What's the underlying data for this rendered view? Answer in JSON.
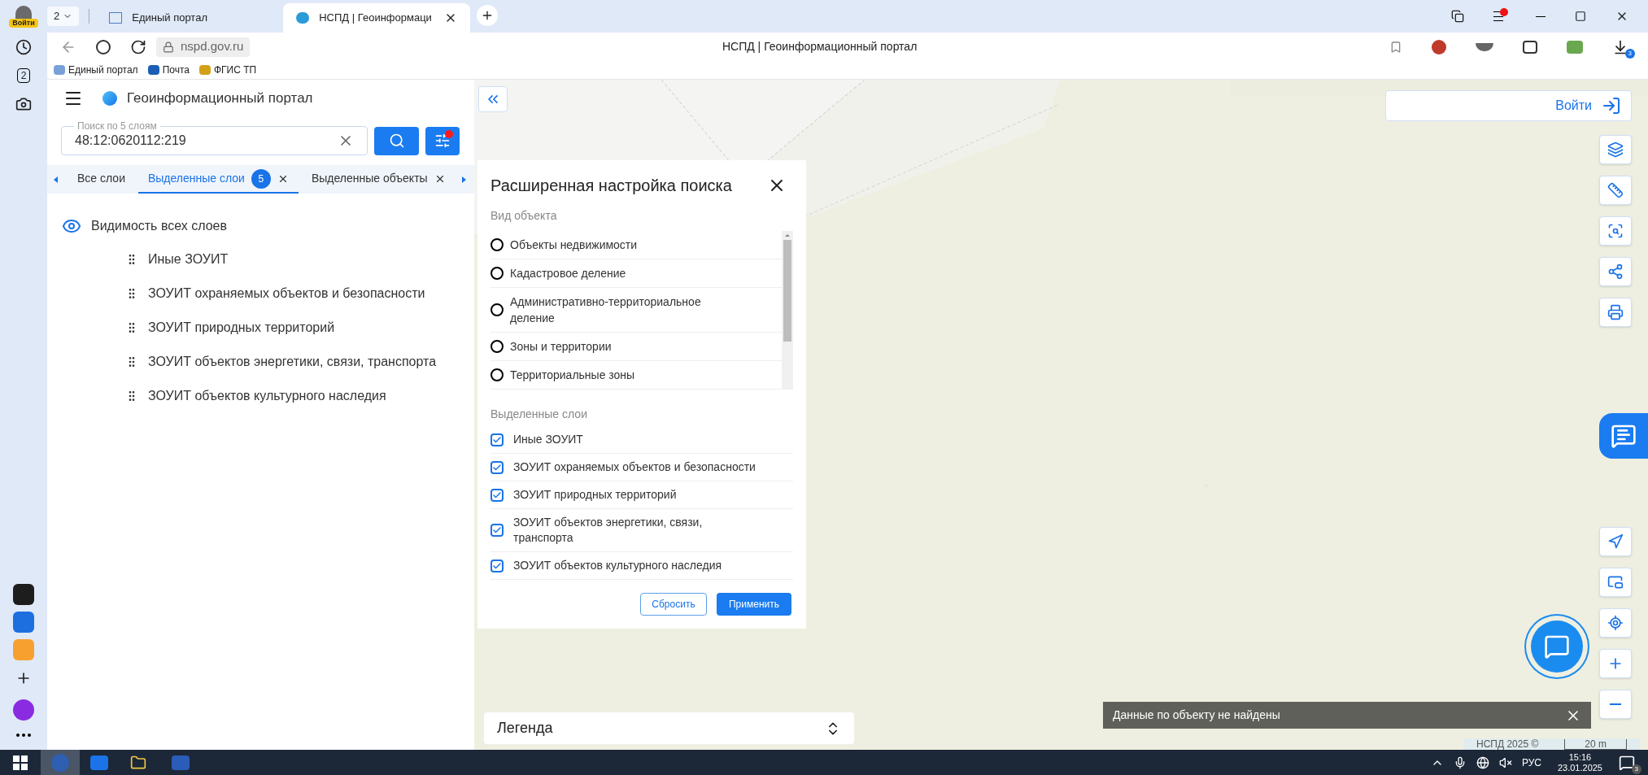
{
  "browser": {
    "profile_label": "Войти",
    "tab_count": "2",
    "tabs": [
      {
        "title": "Единый портал",
        "selected": false
      },
      {
        "title": "НСПД | Геоинформаци",
        "selected": true
      }
    ],
    "url": "nspd.gov.ru",
    "page_title": "НСПД | Геоинформационный портал",
    "bookmarks": [
      "Единый портал",
      "Почта",
      "ФГИС ТП"
    ],
    "sidebar_badge": "2",
    "downloads_badge": "3"
  },
  "app": {
    "title": "Геоинформационный портал",
    "search": {
      "label": "Поиск по 5 слоям",
      "value": "48:12:0620112:219",
      "filter_active": true
    },
    "layer_tabs": [
      {
        "label": "Все слои",
        "selected": false,
        "closable": false
      },
      {
        "label": "Выделенные слои",
        "badge": "5",
        "selected": true,
        "closable": true
      },
      {
        "label": "Выделенные объекты",
        "selected": false,
        "closable": true
      }
    ],
    "visibility_label": "Видимость всех слоев",
    "layers": [
      "Иные ЗОУИТ",
      "ЗОУИТ охраняемых объектов и безопасности",
      "ЗОУИТ природных территорий",
      "ЗОУИТ объектов энергетики, связи, транспорта",
      "ЗОУИТ объектов культурного наследия"
    ],
    "dialog": {
      "title": "Расширенная настройка поиска",
      "type_heading": "Вид объекта",
      "types": [
        {
          "label": "Объекты недвижимости",
          "selected": false
        },
        {
          "label": "Кадастровое деление",
          "selected": false
        },
        {
          "label": "Административно-территориальное деление",
          "selected": false
        },
        {
          "label": "Зоны и территории",
          "selected": false
        },
        {
          "label": "Территориальные зоны",
          "selected": false
        }
      ],
      "layers_heading": "Выделенные слои",
      "layers": [
        {
          "label": "Иные ЗОУИТ",
          "checked": true
        },
        {
          "label": "ЗОУИТ охраняемых объектов и безопасности",
          "checked": true
        },
        {
          "label": "ЗОУИТ природных территорий",
          "checked": true
        },
        {
          "label": "ЗОУИТ объектов энергетики, связи, транспорта",
          "checked": true
        },
        {
          "label": "ЗОУИТ объектов культурного наследия",
          "checked": true
        }
      ],
      "reset": "Сбросить",
      "apply": "Применить"
    },
    "login": "Войти",
    "legend": "Легенда",
    "toast": "Данные по объекту не найдены",
    "copyright": "НСПД 2025 ©",
    "scale": "20 m"
  },
  "taskbar": {
    "language": "РУС",
    "time": "15:16",
    "date": "23.01.2025",
    "notifications": "3"
  }
}
